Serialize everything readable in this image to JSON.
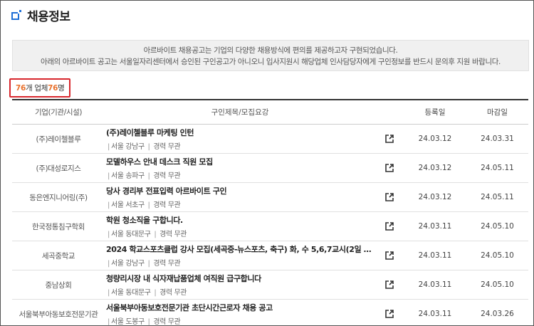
{
  "page": {
    "title": "채용정보"
  },
  "notice": {
    "line1": "아르바이트 채용공고는 기업의 다양한 채용방식에 편의를 제공하고자 구현되었습니다.",
    "line2": "아래의 아르바이트 공고는 서울일자리센터에서 승인된 구인공고가 아니오니 입사지원시 해당업체 인사담당자에게 구인정보를 반드시 문의후 지원 바랍니다."
  },
  "count": {
    "jobs": "76",
    "jobs_unit": "개 업체 ",
    "people": "76",
    "people_unit": "명"
  },
  "table": {
    "headers": {
      "company": "기업(기관/시설)",
      "title": "구인제목/모집요강",
      "registered": "등록일",
      "deadline": "마감일"
    },
    "rows": [
      {
        "company": "(주)레이첼블루",
        "title": "(주)레이첼블루 마케팅 인턴",
        "location": "서울 강남구",
        "career": "경력 무관",
        "registered": "24.03.12",
        "deadline": "24.03.31"
      },
      {
        "company": "(주)대성로지스",
        "title": "모델하우스 안내 데스크 직원 모집",
        "location": "서울 송파구",
        "career": "경력 무관",
        "registered": "24.03.12",
        "deadline": "24.05.11"
      },
      {
        "company": "동은엔지니어링(주)",
        "title": "당사 경리부 전표입력 아르바이트 구인",
        "location": "서울 서초구",
        "career": "경력 무관",
        "registered": "24.03.12",
        "deadline": "24.05.11"
      },
      {
        "company": "한국정통침구학회",
        "title": "학원 청소직을 구합니다.",
        "location": "서울 동대문구",
        "career": "경력 무관",
        "registered": "24.03.11",
        "deadline": "24.05.10"
      },
      {
        "company": "세곡중학교",
        "title": "2024 학교스포츠클럽 강사 모집(세곡중-뉴스포츠, 축구) 화, 수 5,6,7교시(2일 6시...",
        "location": "서울 강남구",
        "career": "경력 무관",
        "registered": "24.03.11",
        "deadline": "24.05.10"
      },
      {
        "company": "중남상회",
        "title": "청량리시장 내 식자재납품업체 여직원 급구합니다",
        "location": "서울 동대문구",
        "career": "경력 무관",
        "registered": "24.03.11",
        "deadline": "24.05.10"
      },
      {
        "company": "서울북부아동보호전문기관",
        "title": "서울북부아동보호전문기관 초단시간근로자 채용 공고",
        "location": "서울 도봉구",
        "career": "경력 무관",
        "registered": "24.03.11",
        "deadline": "24.03.26"
      }
    ]
  },
  "icons": {
    "title": "blue-square-icon",
    "link": "external-link-icon"
  },
  "colors": {
    "accent": "#1f6fd6",
    "count_highlight": "#e9722e",
    "count_border": "#d8262c"
  }
}
